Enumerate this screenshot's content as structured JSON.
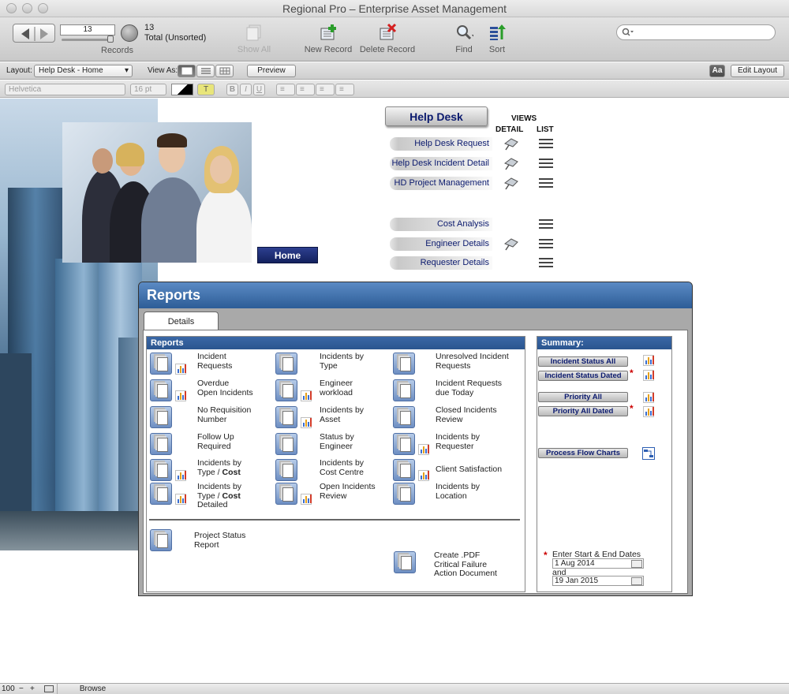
{
  "window": {
    "title": "Regional Pro – Enterprise Asset Management"
  },
  "toolbar": {
    "record_value": "13",
    "records_label": "Records",
    "found_count": "13",
    "found_status": "Total (Unsorted)",
    "show_all": "Show All",
    "new_record": "New Record",
    "delete_record": "Delete Record",
    "find": "Find",
    "sort": "Sort",
    "search_placeholder": ""
  },
  "layoutbar": {
    "layout_label": "Layout:",
    "layout_value": "Help Desk - Home",
    "view_as_label": "View As:",
    "preview": "Preview",
    "aa": "Aa",
    "edit_layout": "Edit Layout"
  },
  "formatbar": {
    "font": "Helvetica",
    "size": "16 pt",
    "bold": "B",
    "italic": "I",
    "underline": "U",
    "text_color": "T"
  },
  "home_button": "Home",
  "helpdesk": {
    "title": "Help Desk",
    "views_label": "VIEWS",
    "detail_label": "DETAIL",
    "list_label": "LIST",
    "items": [
      {
        "label": "Help Desk Request",
        "detail": true
      },
      {
        "label": "Help Desk Incident Detail",
        "detail": true
      },
      {
        "label": "HD Project Management",
        "detail": true
      },
      {
        "label": "Cost Analysis",
        "detail": false
      },
      {
        "label": "Engineer Details",
        "detail": true
      },
      {
        "label": "Requester Details",
        "detail": false
      }
    ]
  },
  "reports_panel": {
    "title": "Reports",
    "tab": "Details",
    "reports_header": "Reports",
    "summary_header": "Summary:",
    "col1": [
      {
        "l1": "Incident",
        "l2": "Requests",
        "chart": true
      },
      {
        "l1": "Overdue",
        "l2": "Open Incidents",
        "chart": true
      },
      {
        "l1": "No Requisition",
        "l2": "Number",
        "chart": false
      },
      {
        "l1": "Follow Up",
        "l2": "Required",
        "chart": false
      },
      {
        "l1": "Incidents by",
        "l2a": "Type / ",
        "l2b": "Cost",
        "chart": true
      },
      {
        "l1": "Incidents by",
        "l2a": "Type / ",
        "l2b": "Cost",
        "l3": "Detailed",
        "chart": true
      }
    ],
    "col2": [
      {
        "l1": "Incidents by",
        "l2": "Type",
        "chart": false
      },
      {
        "l1": "Engineer",
        "l2": "workload",
        "chart": true
      },
      {
        "l1": "Incidents by",
        "l2": "Asset",
        "chart": true
      },
      {
        "l1": "Status by",
        "l2": "Engineer",
        "chart": false
      },
      {
        "l1": "Incidents by",
        "l2": "Cost Centre",
        "chart": false
      },
      {
        "l1": "Open Incidents",
        "l2": "Review",
        "chart": true
      }
    ],
    "col3": [
      {
        "l1": "Unresolved Incident",
        "l2": "Requests",
        "chart": false
      },
      {
        "l1": "Incident  Requests",
        "l2": "due Today",
        "chart": false
      },
      {
        "l1": "Closed Incidents",
        "l2": "Review",
        "chart": false
      },
      {
        "l1": "Incidents by",
        "l2": "Requester",
        "chart": true
      },
      {
        "l1": "Client Satisfaction",
        "l2": "",
        "chart": true
      },
      {
        "l1": "Incidents by",
        "l2": "Location",
        "chart": false
      }
    ],
    "project_status": {
      "l1": "Project Status",
      "l2": "Report"
    },
    "create_pdf": {
      "l1": "Create .PDF",
      "l2": "Critical Failure",
      "l3": "Action Document"
    },
    "summary": {
      "btn1": "Incident Status All",
      "btn2": "Incident Status Dated",
      "btn3": "Priority All",
      "btn4": "Priority All Dated",
      "btn5": "Process Flow Charts",
      "dates_label": "Enter Start & End Dates",
      "start_date": "1 Aug 2014",
      "and_label": "and",
      "end_date": "19 Jan 2015",
      "required_mark": "*"
    }
  },
  "statusbar": {
    "zoom": "100",
    "mode": "Browse"
  }
}
